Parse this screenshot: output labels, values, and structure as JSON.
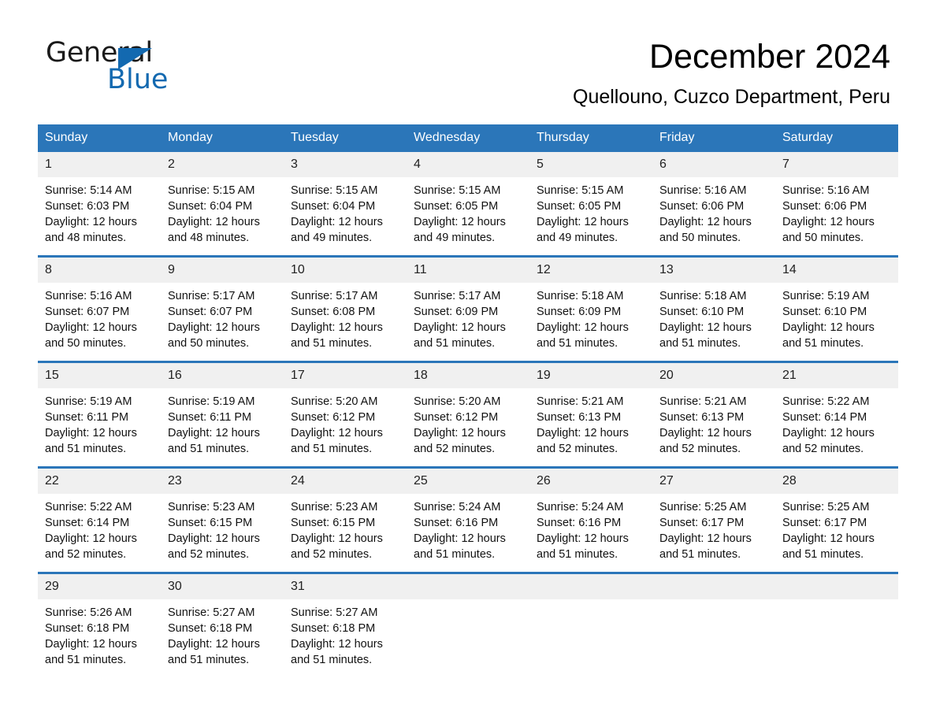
{
  "brand": {
    "name_part1": "General",
    "name_part2": "Blue",
    "accent_color": "#1369b0"
  },
  "header": {
    "title": "December 2024",
    "subtitle": "Quellouno, Cuzco Department, Peru"
  },
  "calendar": {
    "header_bg_color": "#2b76b9",
    "daynum_bg_color": "#f0f0f0",
    "weekday_headers": [
      "Sunday",
      "Monday",
      "Tuesday",
      "Wednesday",
      "Thursday",
      "Friday",
      "Saturday"
    ],
    "weeks": [
      [
        {
          "day": "1",
          "sunrise": "Sunrise: 5:14 AM",
          "sunset": "Sunset: 6:03 PM",
          "daylight_line1": "Daylight: 12 hours",
          "daylight_line2": "and 48 minutes."
        },
        {
          "day": "2",
          "sunrise": "Sunrise: 5:15 AM",
          "sunset": "Sunset: 6:04 PM",
          "daylight_line1": "Daylight: 12 hours",
          "daylight_line2": "and 48 minutes."
        },
        {
          "day": "3",
          "sunrise": "Sunrise: 5:15 AM",
          "sunset": "Sunset: 6:04 PM",
          "daylight_line1": "Daylight: 12 hours",
          "daylight_line2": "and 49 minutes."
        },
        {
          "day": "4",
          "sunrise": "Sunrise: 5:15 AM",
          "sunset": "Sunset: 6:05 PM",
          "daylight_line1": "Daylight: 12 hours",
          "daylight_line2": "and 49 minutes."
        },
        {
          "day": "5",
          "sunrise": "Sunrise: 5:15 AM",
          "sunset": "Sunset: 6:05 PM",
          "daylight_line1": "Daylight: 12 hours",
          "daylight_line2": "and 49 minutes."
        },
        {
          "day": "6",
          "sunrise": "Sunrise: 5:16 AM",
          "sunset": "Sunset: 6:06 PM",
          "daylight_line1": "Daylight: 12 hours",
          "daylight_line2": "and 50 minutes."
        },
        {
          "day": "7",
          "sunrise": "Sunrise: 5:16 AM",
          "sunset": "Sunset: 6:06 PM",
          "daylight_line1": "Daylight: 12 hours",
          "daylight_line2": "and 50 minutes."
        }
      ],
      [
        {
          "day": "8",
          "sunrise": "Sunrise: 5:16 AM",
          "sunset": "Sunset: 6:07 PM",
          "daylight_line1": "Daylight: 12 hours",
          "daylight_line2": "and 50 minutes."
        },
        {
          "day": "9",
          "sunrise": "Sunrise: 5:17 AM",
          "sunset": "Sunset: 6:07 PM",
          "daylight_line1": "Daylight: 12 hours",
          "daylight_line2": "and 50 minutes."
        },
        {
          "day": "10",
          "sunrise": "Sunrise: 5:17 AM",
          "sunset": "Sunset: 6:08 PM",
          "daylight_line1": "Daylight: 12 hours",
          "daylight_line2": "and 51 minutes."
        },
        {
          "day": "11",
          "sunrise": "Sunrise: 5:17 AM",
          "sunset": "Sunset: 6:09 PM",
          "daylight_line1": "Daylight: 12 hours",
          "daylight_line2": "and 51 minutes."
        },
        {
          "day": "12",
          "sunrise": "Sunrise: 5:18 AM",
          "sunset": "Sunset: 6:09 PM",
          "daylight_line1": "Daylight: 12 hours",
          "daylight_line2": "and 51 minutes."
        },
        {
          "day": "13",
          "sunrise": "Sunrise: 5:18 AM",
          "sunset": "Sunset: 6:10 PM",
          "daylight_line1": "Daylight: 12 hours",
          "daylight_line2": "and 51 minutes."
        },
        {
          "day": "14",
          "sunrise": "Sunrise: 5:19 AM",
          "sunset": "Sunset: 6:10 PM",
          "daylight_line1": "Daylight: 12 hours",
          "daylight_line2": "and 51 minutes."
        }
      ],
      [
        {
          "day": "15",
          "sunrise": "Sunrise: 5:19 AM",
          "sunset": "Sunset: 6:11 PM",
          "daylight_line1": "Daylight: 12 hours",
          "daylight_line2": "and 51 minutes."
        },
        {
          "day": "16",
          "sunrise": "Sunrise: 5:19 AM",
          "sunset": "Sunset: 6:11 PM",
          "daylight_line1": "Daylight: 12 hours",
          "daylight_line2": "and 51 minutes."
        },
        {
          "day": "17",
          "sunrise": "Sunrise: 5:20 AM",
          "sunset": "Sunset: 6:12 PM",
          "daylight_line1": "Daylight: 12 hours",
          "daylight_line2": "and 51 minutes."
        },
        {
          "day": "18",
          "sunrise": "Sunrise: 5:20 AM",
          "sunset": "Sunset: 6:12 PM",
          "daylight_line1": "Daylight: 12 hours",
          "daylight_line2": "and 52 minutes."
        },
        {
          "day": "19",
          "sunrise": "Sunrise: 5:21 AM",
          "sunset": "Sunset: 6:13 PM",
          "daylight_line1": "Daylight: 12 hours",
          "daylight_line2": "and 52 minutes."
        },
        {
          "day": "20",
          "sunrise": "Sunrise: 5:21 AM",
          "sunset": "Sunset: 6:13 PM",
          "daylight_line1": "Daylight: 12 hours",
          "daylight_line2": "and 52 minutes."
        },
        {
          "day": "21",
          "sunrise": "Sunrise: 5:22 AM",
          "sunset": "Sunset: 6:14 PM",
          "daylight_line1": "Daylight: 12 hours",
          "daylight_line2": "and 52 minutes."
        }
      ],
      [
        {
          "day": "22",
          "sunrise": "Sunrise: 5:22 AM",
          "sunset": "Sunset: 6:14 PM",
          "daylight_line1": "Daylight: 12 hours",
          "daylight_line2": "and 52 minutes."
        },
        {
          "day": "23",
          "sunrise": "Sunrise: 5:23 AM",
          "sunset": "Sunset: 6:15 PM",
          "daylight_line1": "Daylight: 12 hours",
          "daylight_line2": "and 52 minutes."
        },
        {
          "day": "24",
          "sunrise": "Sunrise: 5:23 AM",
          "sunset": "Sunset: 6:15 PM",
          "daylight_line1": "Daylight: 12 hours",
          "daylight_line2": "and 52 minutes."
        },
        {
          "day": "25",
          "sunrise": "Sunrise: 5:24 AM",
          "sunset": "Sunset: 6:16 PM",
          "daylight_line1": "Daylight: 12 hours",
          "daylight_line2": "and 51 minutes."
        },
        {
          "day": "26",
          "sunrise": "Sunrise: 5:24 AM",
          "sunset": "Sunset: 6:16 PM",
          "daylight_line1": "Daylight: 12 hours",
          "daylight_line2": "and 51 minutes."
        },
        {
          "day": "27",
          "sunrise": "Sunrise: 5:25 AM",
          "sunset": "Sunset: 6:17 PM",
          "daylight_line1": "Daylight: 12 hours",
          "daylight_line2": "and 51 minutes."
        },
        {
          "day": "28",
          "sunrise": "Sunrise: 5:25 AM",
          "sunset": "Sunset: 6:17 PM",
          "daylight_line1": "Daylight: 12 hours",
          "daylight_line2": "and 51 minutes."
        }
      ],
      [
        {
          "day": "29",
          "sunrise": "Sunrise: 5:26 AM",
          "sunset": "Sunset: 6:18 PM",
          "daylight_line1": "Daylight: 12 hours",
          "daylight_line2": "and 51 minutes."
        },
        {
          "day": "30",
          "sunrise": "Sunrise: 5:27 AM",
          "sunset": "Sunset: 6:18 PM",
          "daylight_line1": "Daylight: 12 hours",
          "daylight_line2": "and 51 minutes."
        },
        {
          "day": "31",
          "sunrise": "Sunrise: 5:27 AM",
          "sunset": "Sunset: 6:18 PM",
          "daylight_line1": "Daylight: 12 hours",
          "daylight_line2": "and 51 minutes."
        },
        {
          "day": "",
          "sunrise": "",
          "sunset": "",
          "daylight_line1": "",
          "daylight_line2": ""
        },
        {
          "day": "",
          "sunrise": "",
          "sunset": "",
          "daylight_line1": "",
          "daylight_line2": ""
        },
        {
          "day": "",
          "sunrise": "",
          "sunset": "",
          "daylight_line1": "",
          "daylight_line2": ""
        },
        {
          "day": "",
          "sunrise": "",
          "sunset": "",
          "daylight_line1": "",
          "daylight_line2": ""
        }
      ]
    ]
  }
}
